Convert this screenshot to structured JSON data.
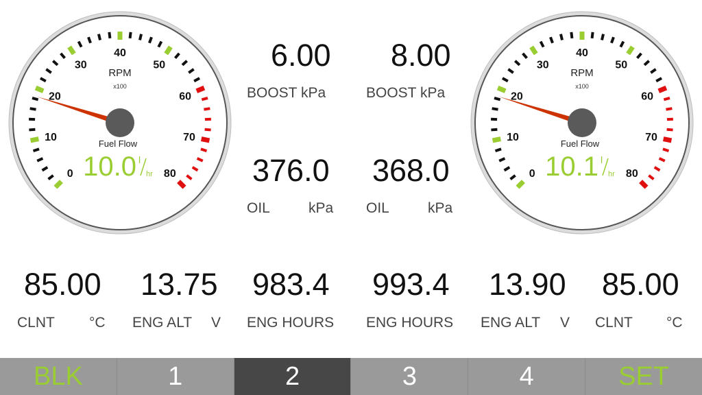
{
  "colors": {
    "accent_green": "#9acd32",
    "tick_black": "#111111",
    "tick_red": "#e01010",
    "needle": "#cc3300",
    "nav_bg": "#9a9a9a",
    "nav_active_bg": "#474747"
  },
  "gauges": [
    {
      "title": "RPM",
      "unit_multiplier": "x100",
      "scale_labels": [
        "0",
        "10",
        "20",
        "30",
        "40",
        "50",
        "60",
        "70",
        "80"
      ],
      "reading_rpm_x100": 18.5,
      "fuel_flow_label": "Fuel Flow",
      "fuel_flow_value": "10.0",
      "fuel_flow_unit_top": "l",
      "fuel_flow_unit_bottom": "hr"
    },
    {
      "title": "RPM",
      "unit_multiplier": "x100",
      "scale_labels": [
        "0",
        "10",
        "20",
        "30",
        "40",
        "50",
        "60",
        "70",
        "80"
      ],
      "reading_rpm_x100": 18.5,
      "fuel_flow_label": "Fuel Flow",
      "fuel_flow_value": "10.1",
      "fuel_flow_unit_top": "l",
      "fuel_flow_unit_bottom": "hr"
    }
  ],
  "center": {
    "boost_left": {
      "value": "6.00",
      "label": "BOOST kPa"
    },
    "boost_right": {
      "value": "8.00",
      "label": "BOOST kPa"
    },
    "oil_left": {
      "value": "376.0",
      "label": "OIL",
      "unit": "kPa"
    },
    "oil_right": {
      "value": "368.0",
      "label": "OIL",
      "unit": "kPa"
    }
  },
  "bottom_readings": [
    {
      "value": "85.00",
      "label": "CLNT",
      "unit": "°C"
    },
    {
      "value": "13.75",
      "label": "ENG ALT",
      "unit": "V"
    },
    {
      "value": "983.4",
      "label": "ENG HOURS",
      "unit": ""
    },
    {
      "value": "993.4",
      "label": "ENG HOURS",
      "unit": ""
    },
    {
      "value": "13.90",
      "label": "ENG ALT",
      "unit": "V"
    },
    {
      "value": "85.00",
      "label": "CLNT",
      "unit": "°C"
    }
  ],
  "nav": {
    "buttons": [
      "BLK",
      "1",
      "2",
      "3",
      "4",
      "SET"
    ],
    "active_index": 2
  }
}
